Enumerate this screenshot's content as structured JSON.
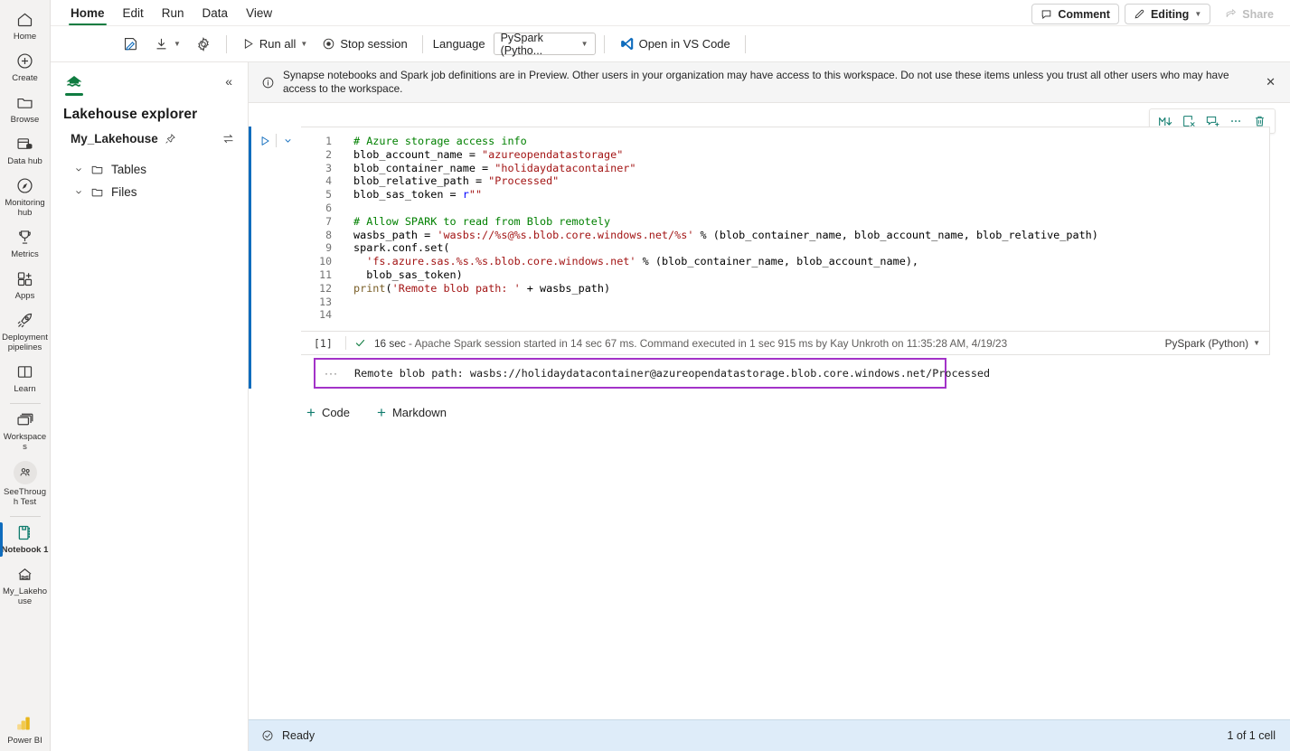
{
  "rail": {
    "items": [
      {
        "label": "Home",
        "icon": "home-icon",
        "selected": false
      },
      {
        "label": "Create",
        "icon": "plus-circle-icon",
        "selected": false
      },
      {
        "label": "Browse",
        "icon": "folder-icon",
        "selected": false
      },
      {
        "label": "Data hub",
        "icon": "data-hub-icon",
        "selected": false
      },
      {
        "label": "Monitoring hub",
        "icon": "monitoring-hub-icon",
        "selected": false
      },
      {
        "label": "Metrics",
        "icon": "trophy-icon",
        "selected": false
      },
      {
        "label": "Apps",
        "icon": "apps-icon",
        "selected": false
      },
      {
        "label": "Deployment pipelines",
        "icon": "deployment-pipelines-icon",
        "selected": false
      },
      {
        "label": "Learn",
        "icon": "learn-book-icon",
        "selected": false
      },
      {
        "label": "Workspaces",
        "icon": "workspaces-icon",
        "selected": false
      },
      {
        "label": "SeeThrough Test",
        "icon": "workspace-avatar-icon",
        "selected": false
      },
      {
        "label": "Notebook 1",
        "icon": "notebook-icon",
        "selected": true
      },
      {
        "label": "My_Lakehouse",
        "icon": "lakehouse-icon",
        "selected": false
      }
    ],
    "bottom": {
      "label": "Power BI",
      "icon": "power-bi-icon"
    }
  },
  "ribbon": {
    "tabs": [
      {
        "label": "Home",
        "active": true
      },
      {
        "label": "Edit",
        "active": false
      },
      {
        "label": "Run",
        "active": false
      },
      {
        "label": "Data",
        "active": false
      },
      {
        "label": "View",
        "active": false
      }
    ],
    "comment_label": "Comment",
    "editing_label": "Editing",
    "share_label": "Share"
  },
  "toolbar": {
    "save_icon": "save-edit-icon",
    "download_icon": "download-icon",
    "settings_icon": "gear-icon",
    "run_all_label": "Run all",
    "stop_session_label": "Stop session",
    "language_label": "Language",
    "language_value": "PySpark (Pytho...",
    "vscode_label": "Open in VS Code"
  },
  "explorer": {
    "title": "Lakehouse explorer",
    "lakehouse_name": "My_Lakehouse",
    "pin_icon": "pin-icon",
    "switch_icon": "switch-lakehouse-icon",
    "collapse_icon": "collapse-chevrons-icon",
    "tree": [
      {
        "label": "Tables",
        "icon": "folder-icon"
      },
      {
        "label": "Files",
        "icon": "folder-icon"
      }
    ]
  },
  "banner": {
    "icon": "info-icon",
    "text": "Synapse notebooks and Spark job definitions are in Preview. Other users in your organization may have access to this workspace. Do not use these items unless you trust all other users who may have access to the workspace.",
    "close_icon": "close-icon"
  },
  "cell_toolbar": {
    "icons": [
      {
        "name": "convert-to-markdown-icon",
        "glyph": "M↓"
      },
      {
        "name": "clear-output-icon",
        "glyph": ""
      },
      {
        "name": "add-comment-icon",
        "glyph": ""
      },
      {
        "name": "more-options-icon",
        "glyph": "···"
      },
      {
        "name": "delete-cell-icon",
        "glyph": ""
      }
    ]
  },
  "cell": {
    "run_icon": "run-cell-icon",
    "more_chevron_icon": "chevron-down-icon",
    "line_numbers": [
      "1",
      "2",
      "3",
      "4",
      "5",
      "6",
      "7",
      "8",
      "9",
      "10",
      "11",
      "12",
      "13",
      "14"
    ],
    "code_lines": [
      {
        "n": 1,
        "text": "# Azure storage access info"
      },
      {
        "n": 2,
        "text": "blob_account_name = \"azureopendatastorage\""
      },
      {
        "n": 3,
        "text": "blob_container_name = \"holidaydatacontainer\""
      },
      {
        "n": 4,
        "text": "blob_relative_path = \"Processed\""
      },
      {
        "n": 5,
        "text": "blob_sas_token = r\"\""
      },
      {
        "n": 6,
        "text": ""
      },
      {
        "n": 7,
        "text": "# Allow SPARK to read from Blob remotely"
      },
      {
        "n": 8,
        "text": "wasbs_path = 'wasbs://%s@%s.blob.core.windows.net/%s' % (blob_container_name, blob_account_name, blob_relative_path)"
      },
      {
        "n": 9,
        "text": "spark.conf.set("
      },
      {
        "n": 10,
        "text": "  'fs.azure.sas.%s.%s.blob.core.windows.net' % (blob_container_name, blob_account_name),"
      },
      {
        "n": 11,
        "text": "  blob_sas_token)"
      },
      {
        "n": 12,
        "text": "print('Remote blob path: ' + wasbs_path)"
      },
      {
        "n": 13,
        "text": ""
      },
      {
        "n": 14,
        "text": ""
      }
    ],
    "status": {
      "index": "[1]",
      "check_icon": "success-check-icon",
      "duration": "16 sec",
      "detail": " - Apache Spark session started in 14 sec 67 ms. Command executed in 1 sec 915 ms by Kay Unkroth on 11:35:28 AM, 4/19/23",
      "language": "PySpark (Python)"
    },
    "output": {
      "dots_icon": "output-more-icon",
      "text": "Remote blob path: wasbs://holidaydatacontainer@azureopendatastorage.blob.core.windows.net/Processed",
      "highlight_color": "#a333c8"
    }
  },
  "add_cell": {
    "code_label": "Code",
    "markdown_label": "Markdown"
  },
  "statusbar": {
    "icon": "ready-status-icon",
    "status": "Ready",
    "cell_count": "1 of 1 cell"
  },
  "colors": {
    "accent_blue": "#0f6cbd",
    "green": "#107c41",
    "teal": "#107c6e",
    "purple": "#a333c8",
    "statusbar_bg": "#deecf9"
  }
}
